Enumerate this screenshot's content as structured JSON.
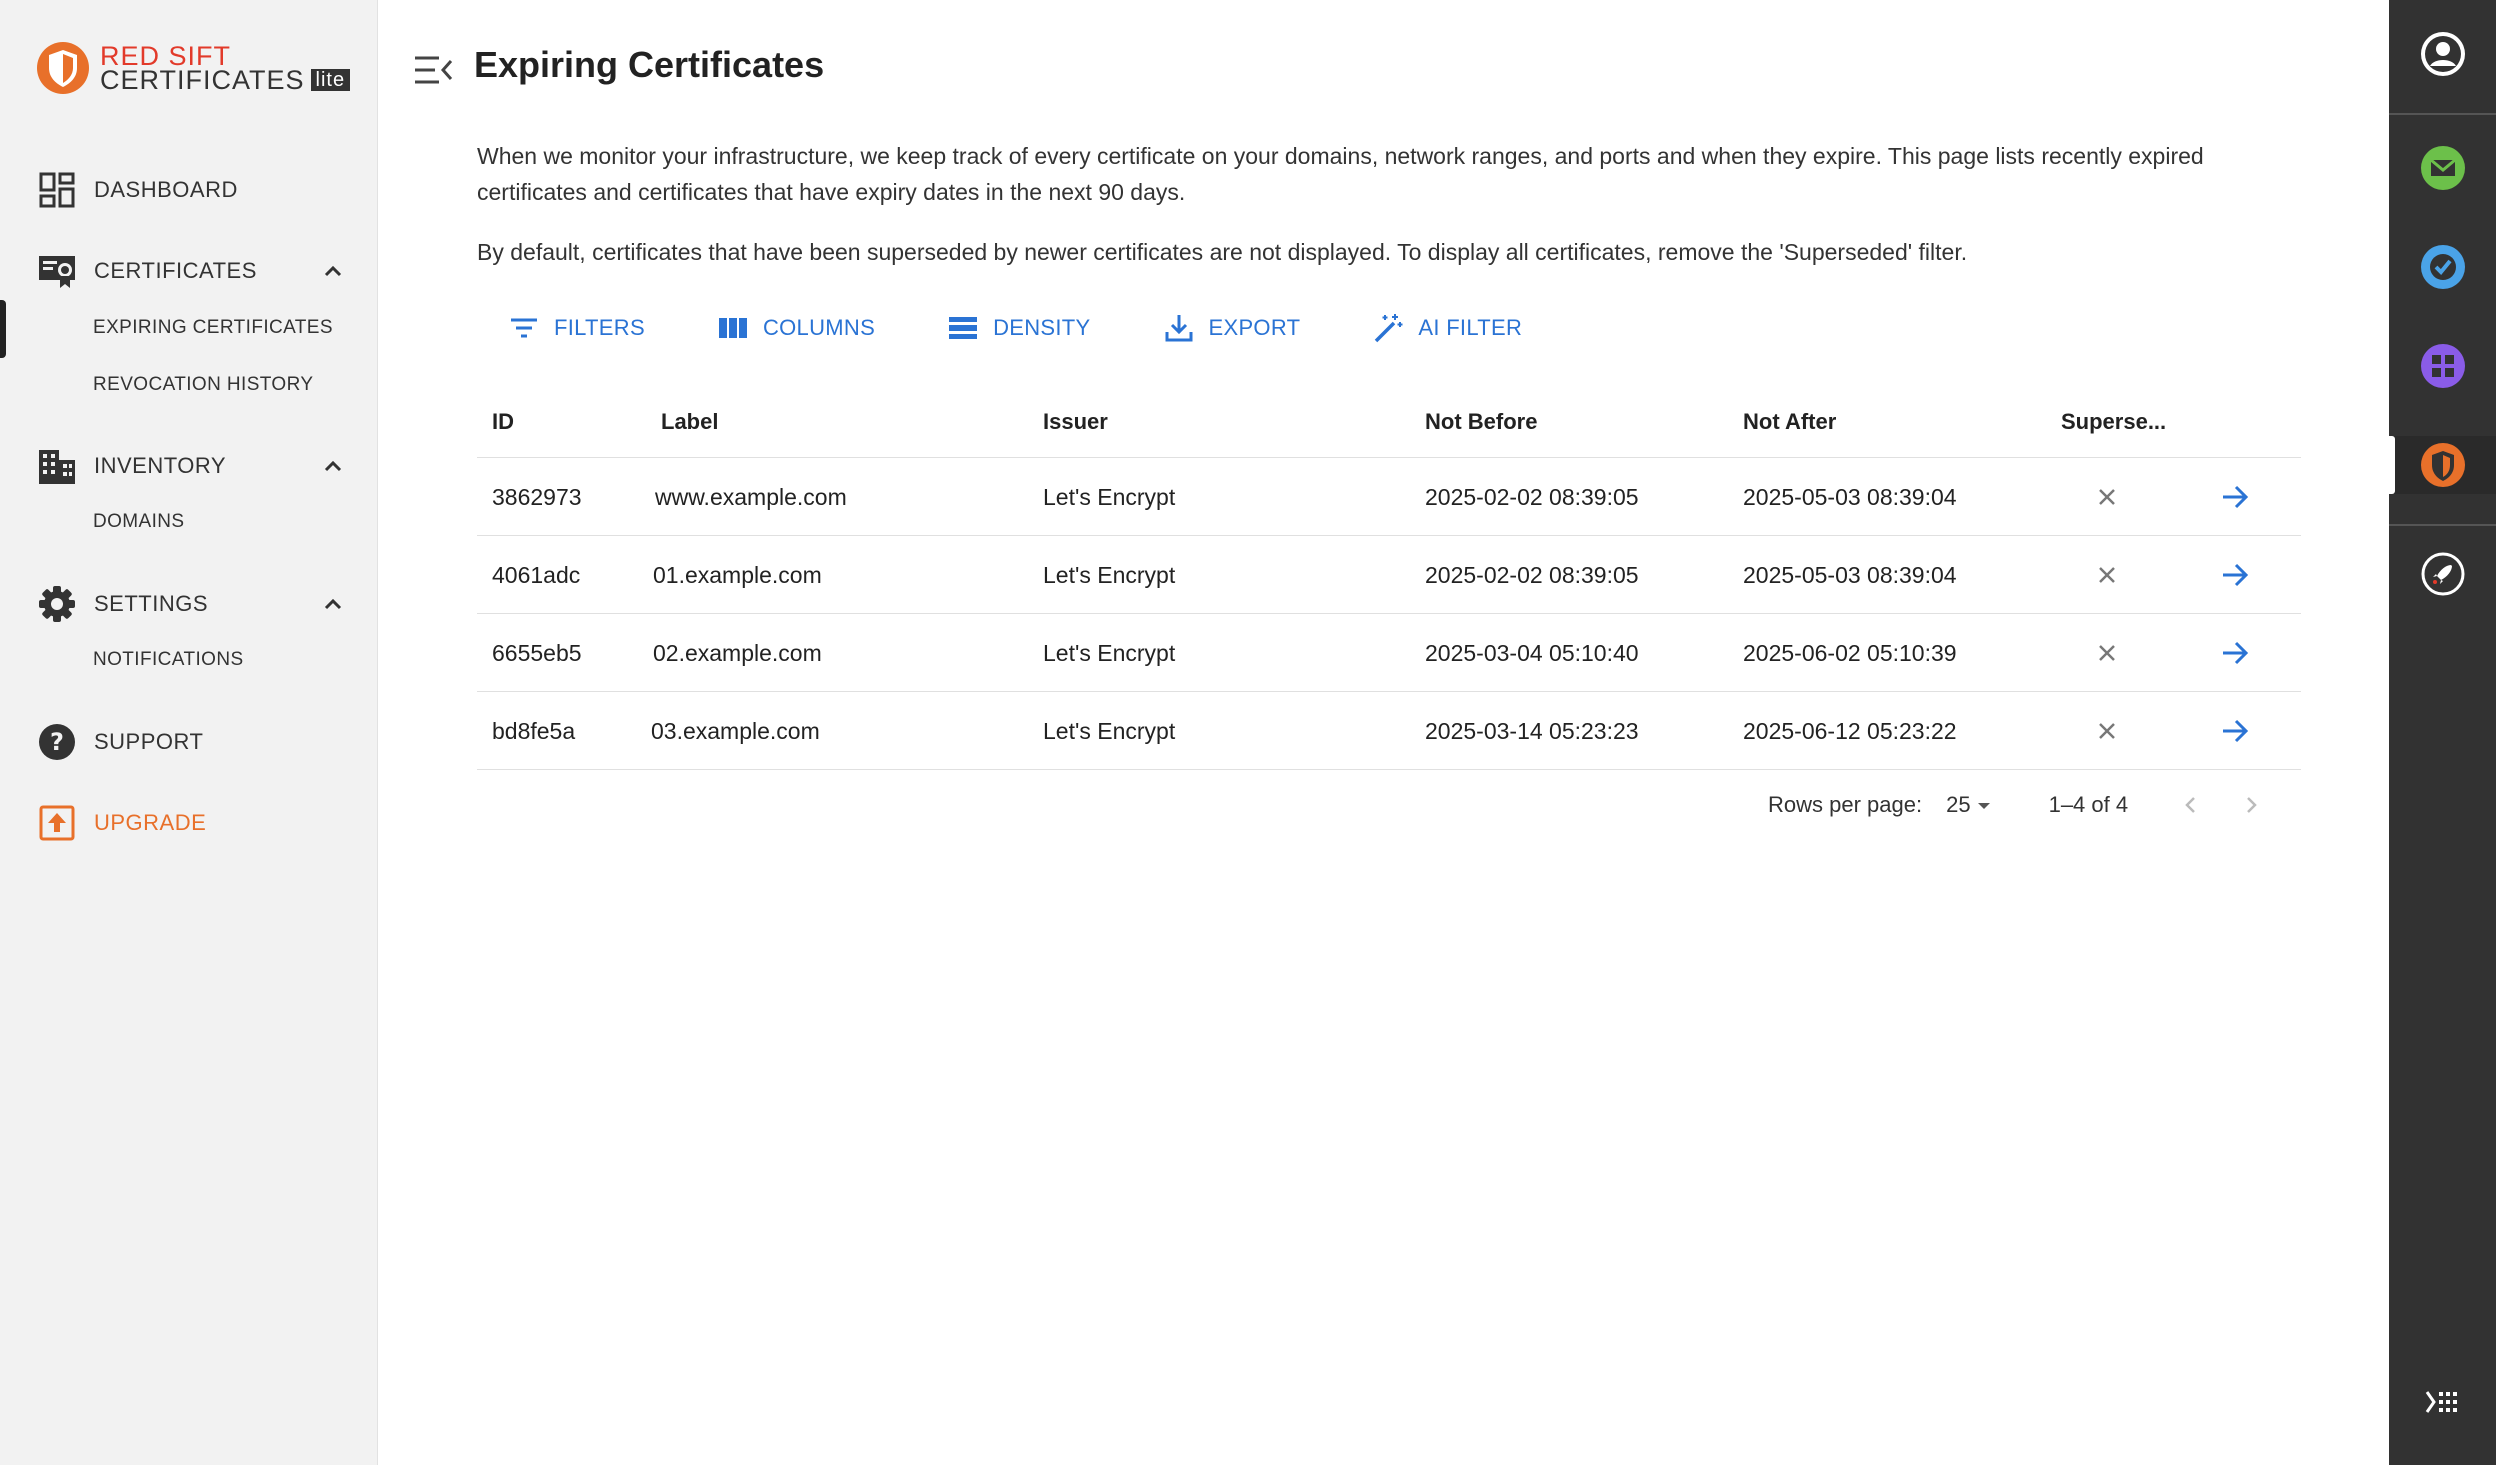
{
  "brand": {
    "line1": "RED SIFT",
    "line2": "CERTIFICATES",
    "badge": "lite"
  },
  "sidebar": {
    "dashboard": "DASHBOARD",
    "certificates": "CERTIFICATES",
    "certificates_sub": [
      "EXPIRING CERTIFICATES",
      "REVOCATION HISTORY"
    ],
    "inventory": "INVENTORY",
    "inventory_sub": [
      "DOMAINS"
    ],
    "settings": "SETTINGS",
    "settings_sub": [
      "NOTIFICATIONS"
    ],
    "support": "SUPPORT",
    "upgrade": "UPGRADE"
  },
  "page": {
    "title": "Expiring Certificates",
    "desc1": "When we monitor your infrastructure, we keep track of every certificate on your domains, network ranges, and ports and when they expire. This page lists recently expired certificates and certificates that have expiry dates in the next 90 days.",
    "desc2": "By default, certificates that have been superseded by newer certificates are not displayed. To display all certificates, remove the 'Superseded' filter."
  },
  "toolbar": {
    "filters": "FILTERS",
    "columns": "COLUMNS",
    "density": "DENSITY",
    "export": "EXPORT",
    "ai_filter": "AI FILTER"
  },
  "table": {
    "headers": {
      "id": "ID",
      "label": "Label",
      "issuer": "Issuer",
      "not_before": "Not Before",
      "not_after": "Not After",
      "superseded": "Superse..."
    },
    "rows": [
      {
        "id": "3862973",
        "label": "www.example.com",
        "issuer": "Let's Encrypt",
        "not_before": "2025-02-02 08:39:05",
        "not_after": "2025-05-03 08:39:04"
      },
      {
        "id": "4061adc",
        "label": "01.example.com",
        "issuer": "Let's Encrypt",
        "not_before": "2025-02-02 08:39:05",
        "not_after": "2025-05-03 08:39:04"
      },
      {
        "id": "6655eb5",
        "label": "02.example.com",
        "issuer": "Let's Encrypt",
        "not_before": "2025-03-04 05:10:40",
        "not_after": "2025-06-02 05:10:39"
      },
      {
        "id": "bd8fe5a",
        "label": "03.example.com",
        "issuer": "Let's Encrypt",
        "not_before": "2025-03-14 05:23:23",
        "not_after": "2025-06-12 05:23:22"
      }
    ]
  },
  "pagination": {
    "rows_per_page_label": "Rows per page:",
    "rows_per_page": "25",
    "range": "1–4 of 4"
  },
  "colors": {
    "accent": "#2a73d4",
    "brand_red": "#e23a2a",
    "upgrade_orange": "#e8702a",
    "rail_bg": "#323232"
  }
}
